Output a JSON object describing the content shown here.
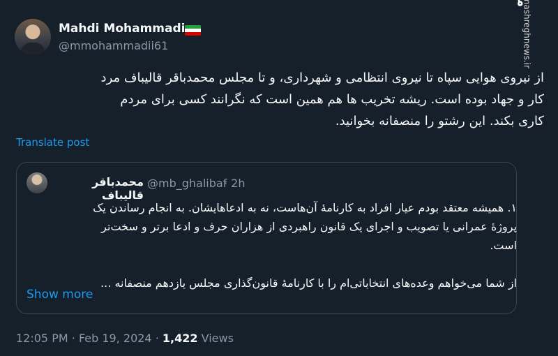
{
  "author": {
    "name": "Mahdi Mohammadi",
    "handle": "@mmohammadii61",
    "flag_colors": [
      "#239f40",
      "#ffffff",
      "#da0000"
    ]
  },
  "watermark": {
    "logo": "مشرق",
    "url": "mashreghnews.ir"
  },
  "post": {
    "lines": [
      "از نیروی هوایی سپاه تا نیروی انتظامی و شهرداری، و تا مجلس محمدباقر قالیباف مرد",
      "کار و جهاد بوده است. ریشه تخریب ها هم همین است که نگرانند کسی برای مردم",
      "کاری بکند. این رشتو را منصفانه بخوانید."
    ],
    "translate_label": "Translate post"
  },
  "quote": {
    "name": "محمدباقر قالیباف",
    "handle": "@mb_ghalibaf",
    "time": "· 2h",
    "lines": [
      "۱. همیشه معتقد بودم عیار افراد به کارنامهٔ آن‌هاست، نه به ادعاهایشان. به انجام رساندن یک",
      "پروژهٔ عمرانی یا تصویب و اجرای یک قانون راهبردی از هزاران حرف و ادعا برتر و سخت‌تر",
      "است.",
      "",
      "از شما می‌خواهم وعده‌های انتخاباتی‌ام را با کارنامهٔ قانون‌گذاری مجلس یازدهم منصفانه ..."
    ],
    "show_more": "Show more"
  },
  "meta": {
    "time": "12:05 PM",
    "sep1": "·",
    "date": "Feb 19, 2024",
    "sep2": "·",
    "views_count": "1,422",
    "views_label": "Views"
  }
}
